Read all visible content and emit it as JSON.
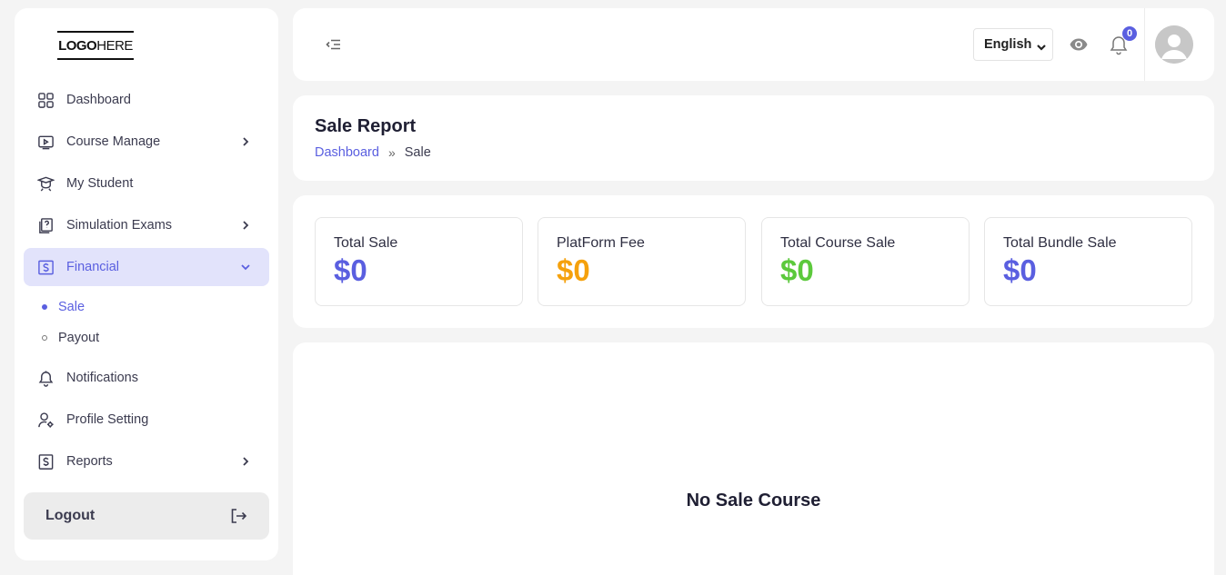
{
  "logo": {
    "bold": "LOGO",
    "light": "HERE"
  },
  "sidebar": {
    "items": [
      {
        "label": "Dashboard",
        "icon": "grid-icon"
      },
      {
        "label": "Course Manage",
        "icon": "play-screen-icon"
      },
      {
        "label": "My Student",
        "icon": "graduation-cap-icon"
      },
      {
        "label": "Simulation Exams",
        "icon": "question-doc-icon"
      },
      {
        "label": "Financial",
        "icon": "dollar-square-icon"
      },
      {
        "label": "Notifications",
        "icon": "bell-icon"
      },
      {
        "label": "Profile Setting",
        "icon": "user-gear-icon"
      },
      {
        "label": "Reports",
        "icon": "dollar-doc-icon"
      }
    ],
    "sub_items": [
      {
        "label": "Sale"
      },
      {
        "label": "Payout"
      }
    ],
    "logout_label": "Logout"
  },
  "topbar": {
    "language": "English",
    "notification_count": "0"
  },
  "header": {
    "title": "Sale Report",
    "breadcrumb": {
      "link": "Dashboard",
      "separator": "»",
      "current": "Sale"
    }
  },
  "stats": [
    {
      "label": "Total Sale",
      "value": "$0",
      "color": "#5a5fe0"
    },
    {
      "label": "PlatForm Fee",
      "value": "$0",
      "color": "#f5a10c"
    },
    {
      "label": "Total Course Sale",
      "value": "$0",
      "color": "#5cc93c"
    },
    {
      "label": "Total Bundle Sale",
      "value": "$0",
      "color": "#5a5fe0"
    }
  ],
  "empty_state": {
    "text": "No Sale Course"
  }
}
